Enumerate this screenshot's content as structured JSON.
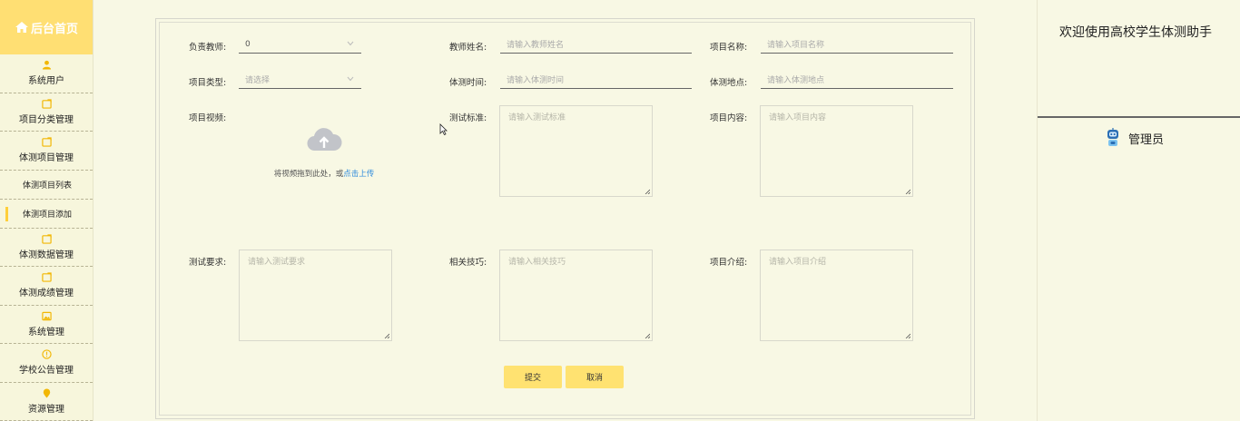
{
  "sidebar": {
    "brand": "后台首页",
    "items": [
      {
        "label": "系统用户",
        "icon": "user-icon"
      },
      {
        "label": "项目分类管理",
        "icon": "folder-icon"
      },
      {
        "label": "体测项目管理",
        "icon": "folder-icon"
      }
    ],
    "sub_items": [
      {
        "label": "体测项目列表"
      },
      {
        "label": "体测项目添加",
        "active": true
      }
    ],
    "items2": [
      {
        "label": "体测数据管理",
        "icon": "folder-icon"
      },
      {
        "label": "体测成绩管理",
        "icon": "folder-icon"
      },
      {
        "label": "系统管理",
        "icon": "image-icon"
      },
      {
        "label": "学校公告管理",
        "icon": "info-icon"
      },
      {
        "label": "资源管理",
        "icon": "location-icon"
      }
    ]
  },
  "form": {
    "teacher_label": "负责教师:",
    "teacher_value": "0",
    "teacher_name_label": "教师姓名:",
    "teacher_name_placeholder": "请输入教师姓名",
    "project_name_label": "项目名称:",
    "project_name_placeholder": "请输入项目名称",
    "type_label": "项目类型:",
    "type_placeholder": "请选择",
    "time_label": "体测时间:",
    "time_placeholder": "请输入体测时间",
    "location_label": "体测地点:",
    "location_placeholder": "请输入体测地点",
    "video_label": "项目视频:",
    "upload_text": "将视频拖到此处，或",
    "upload_link": "点击上传",
    "standard_label": "测试标准:",
    "standard_placeholder": "请输入测试标准",
    "content_label": "项目内容:",
    "content_placeholder": "请输入项目内容",
    "requirement_label": "测试要求:",
    "requirement_placeholder": "请输入测试要求",
    "tips_label": "相关技巧:",
    "tips_placeholder": "请输入相关技巧",
    "intro_label": "项目介绍:",
    "intro_placeholder": "请输入项目介绍",
    "submit": "提交",
    "cancel": "取消"
  },
  "right_panel": {
    "welcome": "欢迎使用高校学生体测助手",
    "role": "管理员"
  },
  "colors": {
    "accent": "#ffdf73",
    "background": "#f8f8e4",
    "link": "#2f8bdc"
  }
}
